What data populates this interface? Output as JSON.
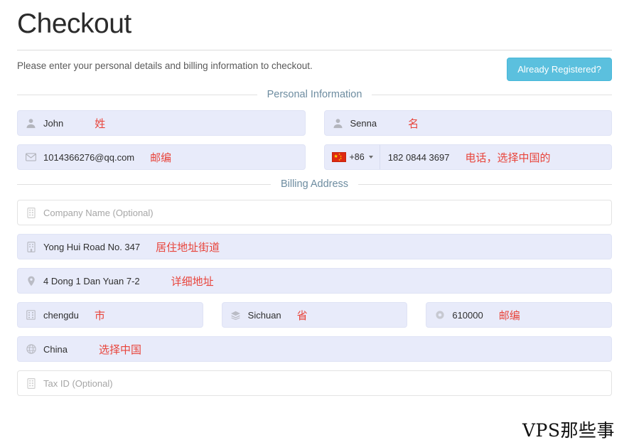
{
  "header": {
    "title": "Checkout",
    "subtitle": "Please enter your personal details and billing information to checkout.",
    "already_registered_label": "Already Registered?",
    "accent_color": "#5bc0de"
  },
  "sections": {
    "personal": "Personal Information",
    "billing": "Billing Address"
  },
  "personal": {
    "first_name": {
      "value": "John",
      "annotation": "姓",
      "icon": "user-icon"
    },
    "last_name": {
      "value": "Senna",
      "annotation": "名",
      "icon": "user-icon"
    },
    "email": {
      "value": "1014366276@qq.com",
      "annotation": "邮编",
      "icon": "envelope-icon"
    },
    "phone": {
      "dial_code": "+86",
      "flag": "china-flag-icon",
      "value": "182 0844 3697",
      "annotation": "电话，选择中国的"
    }
  },
  "billing": {
    "company": {
      "placeholder": "Company Name (Optional)",
      "value": "",
      "icon": "building-icon"
    },
    "address1": {
      "value": "Yong Hui Road No. 347",
      "annotation": "居住地址街道",
      "icon": "building-icon"
    },
    "address2": {
      "value": "4 Dong 1 Dan Yuan 7-2",
      "annotation": "详细地址",
      "icon": "map-pin-icon"
    },
    "city": {
      "value": "chengdu",
      "annotation": "市",
      "icon": "city-icon"
    },
    "state": {
      "value": "Sichuan",
      "annotation": "省",
      "icon": "map-layers-icon"
    },
    "zip": {
      "value": "610000",
      "annotation": "邮编",
      "icon": "circle-icon"
    },
    "country": {
      "value": "China",
      "annotation": "选择中国",
      "icon": "globe-icon"
    },
    "tax_id": {
      "placeholder": "Tax ID (Optional)",
      "value": "",
      "icon": "building-icon"
    }
  },
  "watermark": "VPS那些事",
  "colors": {
    "filled_field_bg": "#e8ebfa",
    "annotation_red": "#e8443b",
    "section_label": "#6d8ca0"
  }
}
